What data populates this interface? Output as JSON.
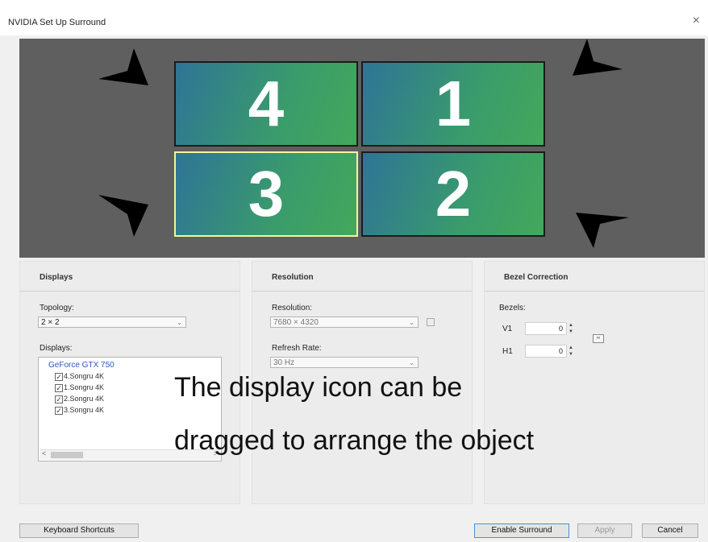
{
  "window": {
    "title": "NVIDIA Set Up Surround",
    "close_glyph": "×"
  },
  "monitors": [
    {
      "id": "4",
      "label": "4"
    },
    {
      "id": "1",
      "label": "1"
    },
    {
      "id": "3",
      "label": "3"
    },
    {
      "id": "2",
      "label": "2"
    }
  ],
  "displays_panel": {
    "heading": "Displays",
    "topology_label": "Topology:",
    "topology_value": "2 × 2",
    "displays_label": "Displays:",
    "gpu": "GeForce GTX 750",
    "items": [
      {
        "label": "4.Songru 4K",
        "checked": true
      },
      {
        "label": "1.Songru 4K",
        "checked": true
      },
      {
        "label": "2.Songru 4K",
        "checked": true
      },
      {
        "label": "3.Songru 4K",
        "checked": true
      }
    ]
  },
  "resolution_panel": {
    "heading": "Resolution",
    "resolution_label": "Resolution:",
    "resolution_value": "7680 × 4320",
    "refresh_label": "Refresh Rate:",
    "refresh_value": "30 Hz"
  },
  "bezel_panel": {
    "heading": "Bezel Correction",
    "bezels_label": "Bezels:",
    "v1_label": "V1",
    "v1_value": "0",
    "h1_label": "H1",
    "h1_value": "0",
    "link_label": "∞"
  },
  "overlay": {
    "line1": "The display icon can be",
    "line2": "dragged to arrange the object"
  },
  "buttons": {
    "keyboard_shortcuts": "Keyboard Shortcuts",
    "enable_surround": "Enable Surround",
    "apply": "Apply",
    "cancel": "Cancel"
  },
  "colors": {
    "canvas_bg": "#5f5f5f",
    "monitor_gradient_start": "#2f7497",
    "monitor_gradient_end": "#44a85b",
    "selected_border": "#f4f59c",
    "gpu_link": "#2a57b8"
  }
}
